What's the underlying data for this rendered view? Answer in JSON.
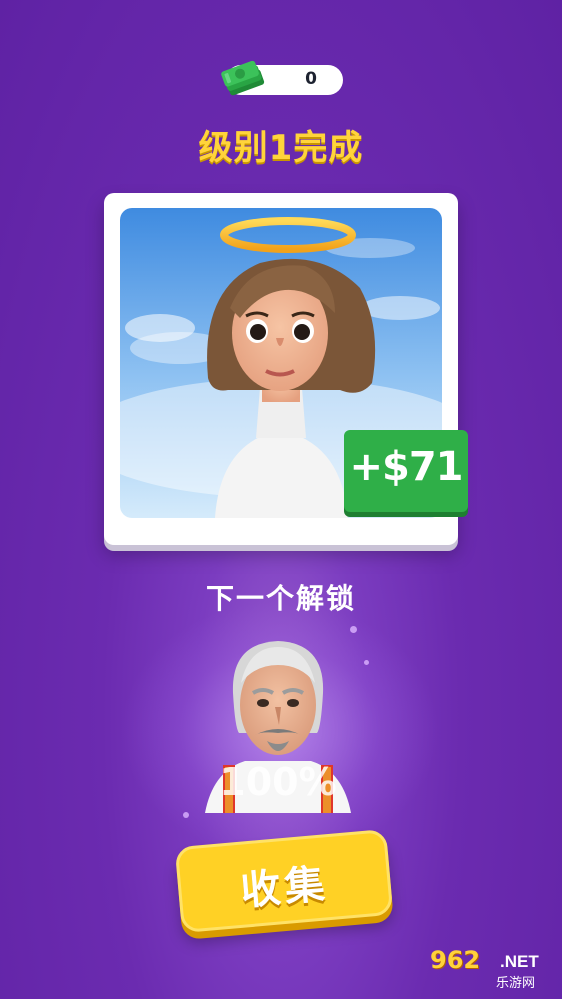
{
  "currency": {
    "icon": "cash-stack-icon",
    "amount": "0"
  },
  "title": "级别1完成",
  "reward": {
    "label": "+$71"
  },
  "next_unlock": {
    "label": "下一个解锁",
    "progress_text": "100%",
    "progress": 1.0
  },
  "collect_button": {
    "label": "收集"
  },
  "watermark": {
    "main": "962",
    "suffix": ".NET",
    "sub": "乐游网"
  },
  "colors": {
    "background": "#6b2bb0",
    "title": "#ffd43b",
    "reward": "#2faf48",
    "button": "#ffd125"
  }
}
